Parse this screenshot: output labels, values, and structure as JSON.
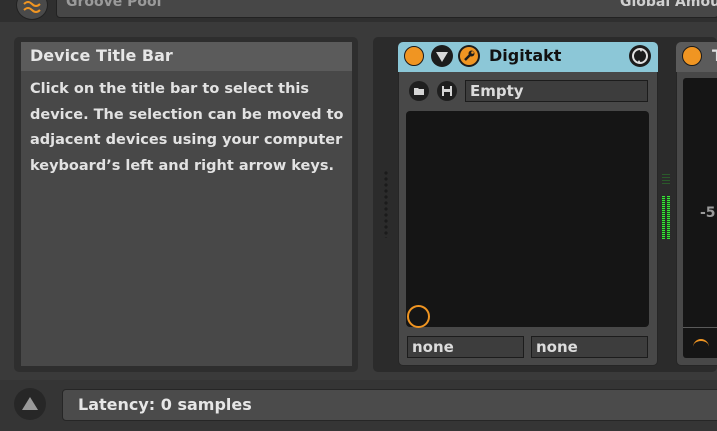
{
  "top": {
    "left_text": "Groove Pool",
    "right_text": "Global Amount"
  },
  "info": {
    "title": "Device Title Bar",
    "body": "Click on the title bar to select this device. The selection can be moved to adjacent devices using your computer keyboard’s left and right arrow keys."
  },
  "device": {
    "name": "Digitakt",
    "preset": "Empty",
    "selector_left": "none",
    "selector_right": "none",
    "icons": [
      "power-icon",
      "fold-triangle-icon",
      "wrench-icon",
      "hot-swap-icon",
      "folder-icon",
      "save-icon"
    ]
  },
  "next_device": {
    "title_fragment": "T",
    "value_label": "-5"
  },
  "status": {
    "latency": "Latency: 0 samples"
  },
  "colors": {
    "accent": "#f09522",
    "title_bar": "#8cc7d7",
    "meter": "#38e638",
    "panel": "#484848"
  }
}
